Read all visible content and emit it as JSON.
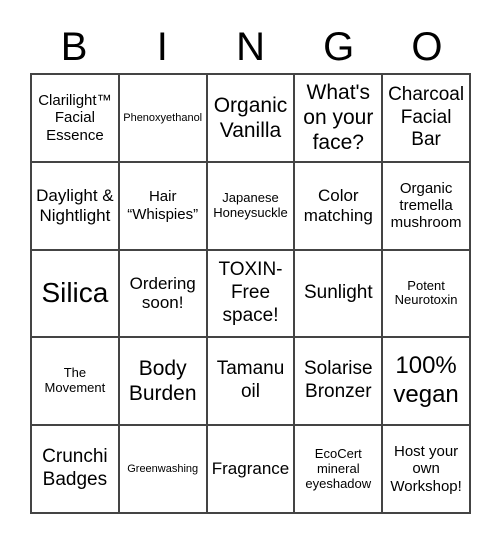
{
  "header": [
    "B",
    "I",
    "N",
    "G",
    "O"
  ],
  "cells": [
    [
      "Clarilight™ Facial Essence",
      "Phenoxyethanol",
      "Organic Vanilla",
      "What's on your face?",
      "Charcoal Facial Bar"
    ],
    [
      "Daylight & Nightlight",
      "Hair “Whispies”",
      "Japanese Honeysuckle",
      "Color matching",
      "Organic tremella mushroom"
    ],
    [
      "Silica",
      "Ordering soon!",
      "TOXIN-Free space!",
      "Sunlight",
      "Potent Neurotoxin"
    ],
    [
      "The Movement",
      "Body Burden",
      "Tamanu oil",
      "Solarise Bronzer",
      "100% vegan"
    ],
    [
      "Crunchi Badges",
      "Greenwashing",
      "Fragrance",
      "EcoCert mineral eyeshadow",
      "Host your own Workshop!"
    ]
  ]
}
